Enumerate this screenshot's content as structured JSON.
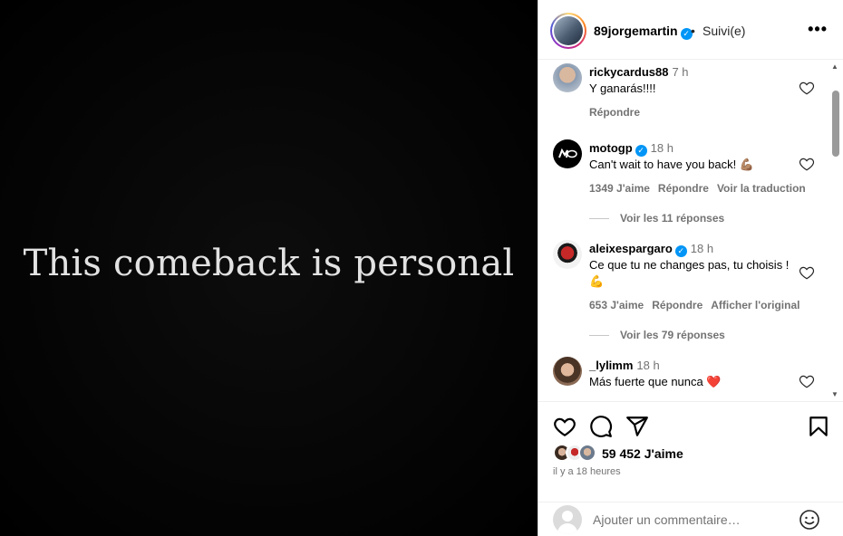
{
  "media": {
    "headline": "This comeback is personal"
  },
  "header": {
    "username": "89jorgemartin",
    "separator": "•",
    "follow_status": "Suivi(e)",
    "more_label": "•••"
  },
  "comments": [
    {
      "user": "rickycardus88",
      "time": "7 h",
      "text": "Y ganarás!!!!",
      "meta": {
        "reply": "Répondre"
      }
    },
    {
      "user": "motogp",
      "verified": true,
      "time": "18 h",
      "text": "Can't wait to have you back! 💪🏽",
      "meta": {
        "likes": "1349 J'aime",
        "reply": "Répondre",
        "action": "Voir la traduction"
      },
      "replies": "Voir les 11 réponses"
    },
    {
      "user": "aleixespargaro",
      "verified": true,
      "time": "18 h",
      "text": "Ce que tu ne changes pas, tu choisis ! 💪",
      "meta": {
        "likes": "653 J'aime",
        "reply": "Répondre",
        "action": "Afficher l'original"
      },
      "replies": "Voir les 79 réponses"
    },
    {
      "user": "_lylimm",
      "time": "18 h",
      "text": "Más fuerte que nunca ❤️"
    }
  ],
  "likes": "59 452 J'aime",
  "posted": "il y a 18 heures",
  "add_comment": {
    "placeholder": "Ajouter un commentaire…"
  },
  "colors": {
    "verified": "#0095f6",
    "meta_gray": "#737373",
    "heart_red": "#ed4956"
  }
}
